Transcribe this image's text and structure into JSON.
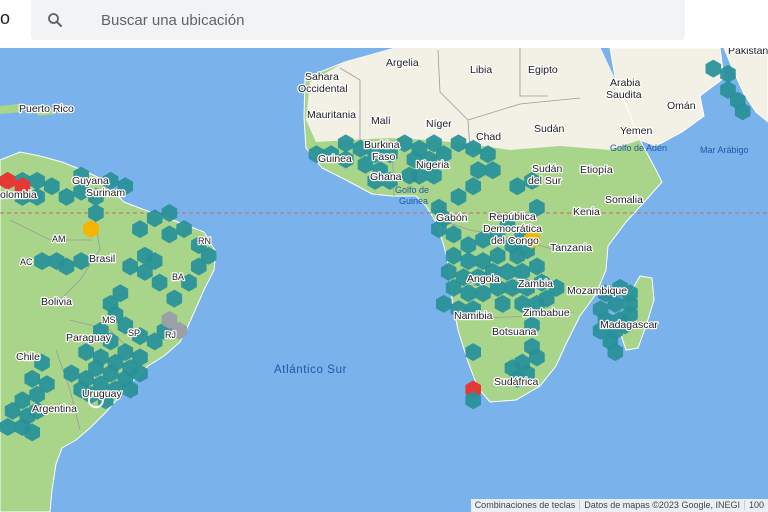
{
  "search": {
    "placeholder": "Buscar una ubicación",
    "icon": "search-icon"
  },
  "map": {
    "colors": {
      "ocean": "#7ab2ec",
      "land_green": "#a8d58a",
      "land_sand": "#f3f0e6",
      "border": "#9a9a9a",
      "equator": "#c46a6a",
      "hex_teal": "#279098",
      "hex_red": "#e53935",
      "hex_yellow": "#f4b400",
      "hex_gray": "#9aa0a6"
    },
    "labels": {
      "pakistan": "Pakistán",
      "sahara": "Sahara\nOccidental",
      "argelia": "Argelia",
      "libia": "Libia",
      "egipto": "Egipto",
      "arabia": "Arabia\nSaudita",
      "oman": "Omán",
      "mauritania": "Mauritania",
      "mali": "Malí",
      "niger": "Níger",
      "chad": "Chad",
      "sudan": "Sudán",
      "yemen": "Yemen",
      "golfo_aden": "Golfo de Adén",
      "mar_arabigo": "Mar Arábigo",
      "puerto_rico": "Puerto Rico",
      "guinea": "Guinea",
      "burkina": "Burkina\nFaso",
      "nigeria": "Nigeria",
      "ghana": "Ghana",
      "golfo_guinea": "Golfo de\nGuinea",
      "sudan_sur": "Sudán\ndel Sur",
      "etiopia": "Etiopía",
      "somalia": "Somalia",
      "kenia": "Kenia",
      "gabon": "Gabón",
      "rdc": "República\nDemocrática\ndel Congo",
      "tanzania": "Tanzania",
      "colombia": "olombia",
      "guyana": "Guyana",
      "surinam": "Surinam",
      "am": "AM",
      "brasil": "Brasil",
      "rn": "RN",
      "ac": "AC",
      "ba": "BA",
      "bolivia": "Bolivia",
      "ms": "MS",
      "sp": "SP",
      "rj": "RJ",
      "paraguay": "Paraguay",
      "chile": "Chile",
      "uruguay": "Uruguay",
      "argentina": "Argentina",
      "angola": "Angola",
      "zambia": "Zambia",
      "mozambique": "Mozambique",
      "zimbabue": "Zimbabue",
      "madagascar": "Madagascar",
      "namibia": "Namibia",
      "botsuana": "Botsuana",
      "sudafrica": "Sudáfrica",
      "atlantico_sur": "Atlántico Sur"
    },
    "hexes": [
      {
        "lon": -56,
        "lat": 6,
        "c": "teal"
      },
      {
        "lon": -53,
        "lat": 5,
        "c": "teal"
      },
      {
        "lon": -59,
        "lat": 3,
        "c": "teal"
      },
      {
        "lon": -62,
        "lat": 4,
        "c": "teal"
      },
      {
        "lon": -65,
        "lat": 3,
        "c": "teal"
      },
      {
        "lon": -68,
        "lat": 5,
        "c": "teal"
      },
      {
        "lon": -71,
        "lat": 6,
        "c": "teal"
      },
      {
        "lon": -74,
        "lat": 6,
        "c": "teal"
      },
      {
        "lon": -74,
        "lat": 3,
        "c": "teal"
      },
      {
        "lon": -71,
        "lat": 3,
        "c": "teal"
      },
      {
        "lon": -77,
        "lat": 6,
        "c": "red"
      },
      {
        "lon": -74,
        "lat": 5,
        "c": "red"
      },
      {
        "lon": -62,
        "lat": 7,
        "c": "teal"
      },
      {
        "lon": -59,
        "lat": 0,
        "c": "teal"
      },
      {
        "lon": -60,
        "lat": -3,
        "c": "yellow"
      },
      {
        "lon": -50,
        "lat": -3,
        "c": "teal"
      },
      {
        "lon": -47,
        "lat": -1,
        "c": "teal"
      },
      {
        "lon": -44,
        "lat": 0,
        "c": "teal"
      },
      {
        "lon": -44,
        "lat": -4,
        "c": "teal"
      },
      {
        "lon": -41,
        "lat": -3,
        "c": "teal"
      },
      {
        "lon": -38,
        "lat": -6,
        "c": "teal"
      },
      {
        "lon": -36,
        "lat": -8,
        "c": "teal"
      },
      {
        "lon": -38,
        "lat": -10,
        "c": "teal"
      },
      {
        "lon": -40,
        "lat": -13,
        "c": "teal"
      },
      {
        "lon": -43,
        "lat": -16,
        "c": "teal"
      },
      {
        "lon": -46,
        "lat": -13,
        "c": "teal"
      },
      {
        "lon": -49,
        "lat": -8,
        "c": "teal"
      },
      {
        "lon": -49,
        "lat": -11,
        "c": "teal"
      },
      {
        "lon": -52,
        "lat": -10,
        "c": "teal"
      },
      {
        "lon": -47,
        "lat": -9,
        "c": "teal"
      },
      {
        "lon": -70,
        "lat": -9,
        "c": "teal"
      },
      {
        "lon": -67,
        "lat": -9,
        "c": "teal"
      },
      {
        "lon": -65,
        "lat": -10,
        "c": "teal"
      },
      {
        "lon": -62,
        "lat": -9,
        "c": "teal"
      },
      {
        "lon": -45,
        "lat": -22,
        "c": "teal"
      },
      {
        "lon": -42,
        "lat": -22,
        "c": "gray"
      },
      {
        "lon": -44,
        "lat": -20,
        "c": "gray"
      },
      {
        "lon": -47,
        "lat": -24,
        "c": "teal"
      },
      {
        "lon": -50,
        "lat": -23,
        "c": "teal"
      },
      {
        "lon": -53,
        "lat": -21,
        "c": "teal"
      },
      {
        "lon": -55,
        "lat": -19,
        "c": "teal"
      },
      {
        "lon": -56,
        "lat": -17,
        "c": "teal"
      },
      {
        "lon": -54,
        "lat": -15,
        "c": "teal"
      },
      {
        "lon": -58,
        "lat": -22,
        "c": "teal"
      },
      {
        "lon": -56,
        "lat": -24,
        "c": "teal"
      },
      {
        "lon": -53,
        "lat": -26,
        "c": "teal"
      },
      {
        "lon": -50,
        "lat": -27,
        "c": "teal"
      },
      {
        "lon": -52,
        "lat": -29,
        "c": "teal"
      },
      {
        "lon": -55,
        "lat": -28,
        "c": "teal"
      },
      {
        "lon": -58,
        "lat": -27,
        "c": "teal"
      },
      {
        "lon": -61,
        "lat": -26,
        "c": "teal"
      },
      {
        "lon": -59,
        "lat": -29,
        "c": "teal"
      },
      {
        "lon": -56,
        "lat": -30,
        "c": "teal"
      },
      {
        "lon": -53,
        "lat": -31,
        "c": "teal"
      },
      {
        "lon": -50,
        "lat": -30,
        "c": "teal"
      },
      {
        "lon": -55,
        "lat": -33,
        "c": "teal"
      },
      {
        "lon": -58,
        "lat": -32,
        "c": "teal"
      },
      {
        "lon": -61,
        "lat": -31,
        "c": "teal"
      },
      {
        "lon": -64,
        "lat": -30,
        "c": "teal"
      },
      {
        "lon": -62,
        "lat": -33,
        "c": "teal"
      },
      {
        "lon": -60,
        "lat": -34,
        "c": "teal"
      },
      {
        "lon": -57,
        "lat": -35,
        "c": "teal"
      },
      {
        "lon": -52,
        "lat": -33,
        "c": "teal"
      },
      {
        "lon": -70,
        "lat": -28,
        "c": "teal"
      },
      {
        "lon": -72,
        "lat": -31,
        "c": "teal"
      },
      {
        "lon": -69,
        "lat": -32,
        "c": "teal"
      },
      {
        "lon": -71,
        "lat": -34,
        "c": "teal"
      },
      {
        "lon": -74,
        "lat": -35,
        "c": "teal"
      },
      {
        "lon": -71,
        "lat": -37,
        "c": "teal"
      },
      {
        "lon": -73,
        "lat": -38,
        "c": "teal"
      },
      {
        "lon": -76,
        "lat": -37,
        "c": "teal"
      },
      {
        "lon": -74,
        "lat": -40,
        "c": "teal"
      },
      {
        "lon": -77,
        "lat": -40,
        "c": "teal"
      },
      {
        "lon": -72,
        "lat": -41,
        "c": "teal"
      },
      {
        "lon": -14,
        "lat": 11,
        "c": "teal"
      },
      {
        "lon": -11,
        "lat": 11,
        "c": "teal"
      },
      {
        "lon": -8,
        "lat": 10,
        "c": "teal"
      },
      {
        "lon": -8,
        "lat": 13,
        "c": "teal"
      },
      {
        "lon": -5,
        "lat": 12,
        "c": "teal"
      },
      {
        "lon": -2,
        "lat": 11,
        "c": "teal"
      },
      {
        "lon": 1,
        "lat": 11,
        "c": "teal"
      },
      {
        "lon": -4,
        "lat": 9,
        "c": "teal"
      },
      {
        "lon": -1,
        "lat": 8,
        "c": "teal"
      },
      {
        "lon": 1,
        "lat": 6,
        "c": "teal"
      },
      {
        "lon": -2,
        "lat": 6,
        "c": "teal"
      },
      {
        "lon": 4,
        "lat": 13,
        "c": "teal"
      },
      {
        "lon": 7,
        "lat": 12,
        "c": "teal"
      },
      {
        "lon": 10,
        "lat": 13,
        "c": "teal"
      },
      {
        "lon": 6,
        "lat": 10,
        "c": "teal"
      },
      {
        "lon": 9,
        "lat": 10,
        "c": "teal"
      },
      {
        "lon": 12,
        "lat": 11,
        "c": "teal"
      },
      {
        "lon": 7,
        "lat": 7,
        "c": "teal"
      },
      {
        "lon": 5,
        "lat": 7,
        "c": "teal"
      },
      {
        "lon": 10,
        "lat": 7,
        "c": "teal"
      },
      {
        "lon": 15,
        "lat": 13,
        "c": "teal"
      },
      {
        "lon": 18,
        "lat": 12,
        "c": "teal"
      },
      {
        "lon": 21,
        "lat": 11,
        "c": "teal"
      },
      {
        "lon": 22,
        "lat": 8,
        "c": "teal"
      },
      {
        "lon": 19,
        "lat": 8,
        "c": "teal"
      },
      {
        "lon": 30,
        "lat": 6,
        "c": "teal"
      },
      {
        "lon": 27,
        "lat": 5,
        "c": "teal"
      },
      {
        "lon": 18,
        "lat": 5,
        "c": "teal"
      },
      {
        "lon": 15,
        "lat": 3,
        "c": "teal"
      },
      {
        "lon": 11,
        "lat": 1,
        "c": "teal"
      },
      {
        "lon": 12,
        "lat": -1,
        "c": "teal"
      },
      {
        "lon": 11,
        "lat": -3,
        "c": "teal"
      },
      {
        "lon": 14,
        "lat": -4,
        "c": "teal"
      },
      {
        "lon": 31,
        "lat": 1,
        "c": "teal"
      },
      {
        "lon": 25,
        "lat": -2,
        "c": "teal"
      },
      {
        "lon": 23,
        "lat": -4,
        "c": "teal"
      },
      {
        "lon": 20,
        "lat": -5,
        "c": "teal"
      },
      {
        "lon": 17,
        "lat": -6,
        "c": "teal"
      },
      {
        "lon": 14,
        "lat": -8,
        "c": "teal"
      },
      {
        "lon": 17,
        "lat": -9,
        "c": "teal"
      },
      {
        "lon": 20,
        "lat": -9,
        "c": "teal"
      },
      {
        "lon": 23,
        "lat": -8,
        "c": "teal"
      },
      {
        "lon": 26,
        "lat": -6,
        "c": "teal"
      },
      {
        "lon": 28,
        "lat": -4,
        "c": "teal"
      },
      {
        "lon": 27,
        "lat": -8,
        "c": "teal"
      },
      {
        "lon": 29,
        "lat": -7,
        "c": "teal"
      },
      {
        "lon": 30,
        "lat": -5,
        "c": "yellow"
      },
      {
        "lon": 13,
        "lat": -11,
        "c": "teal"
      },
      {
        "lon": 16,
        "lat": -12,
        "c": "teal"
      },
      {
        "lon": 19,
        "lat": -12,
        "c": "teal"
      },
      {
        "lon": 22,
        "lat": -11,
        "c": "teal"
      },
      {
        "lon": 25,
        "lat": -11,
        "c": "teal"
      },
      {
        "lon": 28,
        "lat": -11,
        "c": "teal"
      },
      {
        "lon": 31,
        "lat": -10,
        "c": "teal"
      },
      {
        "lon": 14,
        "lat": -14,
        "c": "teal"
      },
      {
        "lon": 17,
        "lat": -15,
        "c": "teal"
      },
      {
        "lon": 20,
        "lat": -15,
        "c": "teal"
      },
      {
        "lon": 23,
        "lat": -14,
        "c": "teal"
      },
      {
        "lon": 26,
        "lat": -14,
        "c": "teal"
      },
      {
        "lon": 29,
        "lat": -14,
        "c": "teal"
      },
      {
        "lon": 32,
        "lat": -13,
        "c": "teal"
      },
      {
        "lon": 35,
        "lat": -14,
        "c": "teal"
      },
      {
        "lon": 12,
        "lat": -17,
        "c": "teal"
      },
      {
        "lon": 15,
        "lat": -18,
        "c": "teal"
      },
      {
        "lon": 18,
        "lat": -18,
        "c": "teal"
      },
      {
        "lon": 24,
        "lat": -17,
        "c": "teal"
      },
      {
        "lon": 28,
        "lat": -17,
        "c": "teal"
      },
      {
        "lon": 31,
        "lat": -17,
        "c": "teal"
      },
      {
        "lon": 33,
        "lat": -16,
        "c": "teal"
      },
      {
        "lon": 30,
        "lat": -21,
        "c": "teal"
      },
      {
        "lon": 18,
        "lat": -26,
        "c": "teal"
      },
      {
        "lon": 30,
        "lat": -25,
        "c": "teal"
      },
      {
        "lon": 31,
        "lat": -27,
        "c": "teal"
      },
      {
        "lon": 28,
        "lat": -28,
        "c": "teal"
      },
      {
        "lon": 26,
        "lat": -29,
        "c": "teal"
      },
      {
        "lon": 29,
        "lat": -30,
        "c": "teal"
      },
      {
        "lon": 27,
        "lat": -31,
        "c": "teal"
      },
      {
        "lon": 18,
        "lat": -33,
        "c": "red"
      },
      {
        "lon": 18,
        "lat": -35,
        "c": "teal"
      },
      {
        "lon": 45,
        "lat": -15,
        "c": "teal"
      },
      {
        "lon": 48,
        "lat": -14,
        "c": "teal"
      },
      {
        "lon": 50,
        "lat": -15,
        "c": "teal"
      },
      {
        "lon": 44,
        "lat": -18,
        "c": "teal"
      },
      {
        "lon": 47,
        "lat": -17,
        "c": "teal"
      },
      {
        "lon": 50,
        "lat": -17,
        "c": "teal"
      },
      {
        "lon": 45,
        "lat": -20,
        "c": "teal"
      },
      {
        "lon": 48,
        "lat": -20,
        "c": "teal"
      },
      {
        "lon": 50,
        "lat": -19,
        "c": "teal"
      },
      {
        "lon": 44,
        "lat": -22,
        "c": "teal"
      },
      {
        "lon": 47,
        "lat": -22,
        "c": "teal"
      },
      {
        "lon": 49,
        "lat": -21,
        "c": "teal"
      },
      {
        "lon": 46,
        "lat": -24,
        "c": "teal"
      },
      {
        "lon": 47,
        "lat": -26,
        "c": "teal"
      },
      {
        "lon": 67,
        "lat": 27,
        "c": "teal"
      },
      {
        "lon": 70,
        "lat": 26,
        "c": "teal"
      },
      {
        "lon": 70,
        "lat": 23,
        "c": "teal"
      },
      {
        "lon": 72,
        "lat": 21,
        "c": "teal"
      },
      {
        "lon": 73,
        "lat": 19,
        "c": "teal"
      }
    ],
    "marker": {
      "lon": -59,
      "lat": -35,
      "icon": "location-ring-icon"
    }
  },
  "attribution": {
    "shortcuts": "Combinaciones de teclas",
    "data": "Datos de mapas ©2023 Google, INEGI",
    "scale": "100"
  },
  "edge_glyph": "o"
}
